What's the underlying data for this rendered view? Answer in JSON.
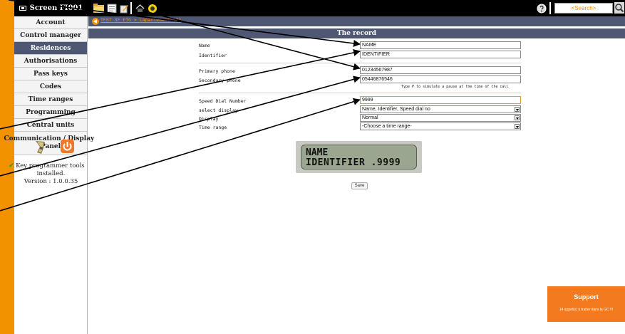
{
  "topbar": {
    "screen_label": "Screen FI001",
    "search_placeholder": "<Search>"
  },
  "sidebar": {
    "items": [
      {
        "label": "Account"
      },
      {
        "label": "Control manager"
      },
      {
        "label": "Residences",
        "active": true
      },
      {
        "label": "Authorisations"
      },
      {
        "label": "Pass keys"
      },
      {
        "label": "Codes"
      },
      {
        "label": "Time ranges"
      },
      {
        "label": "Programming"
      },
      {
        "label": "Central units"
      },
      {
        "label_line1": "Communication / Display",
        "label_line2": "Panel"
      }
    ],
    "programmer": {
      "line1": "Key programmer tools",
      "line2": "installed.",
      "line3": "Version : 1.0.0.35"
    }
  },
  "breadcrumb": {
    "text": "TEST 3E ETG > Lapartement 101"
  },
  "record": {
    "title": "The record"
  },
  "form": {
    "name_label": "Name",
    "name_value": "NAME",
    "identifier_label": "Identifier",
    "identifier_value": "IDENTIFIER",
    "primary_phone_label": "Primary phone",
    "primary_phone_value": "01234567987",
    "secondary_phone_label": "Secondary phone",
    "secondary_phone_value": "05446876546",
    "hint": "Type P to simulate a pause at the time of the call",
    "speed_dial_label": "Speed Dial Number",
    "speed_dial_value": "9999",
    "select_display_label": "select display",
    "select_display_value": "Name, Identifier, Speed dial no",
    "display_label": "Display",
    "display_value": "Normal",
    "time_range_label": "Time range",
    "time_range_value": "-Choose a time range-"
  },
  "lcd": {
    "line1": "NAME",
    "line2": "IDENTIFIER .9999"
  },
  "save_label": "Save",
  "support": {
    "title": "Support",
    "subtitle": "14 appel(s) à traiter dans la GC !!!"
  },
  "colors": {
    "orange": "#f39200",
    "navy": "#4f5873",
    "support": "#f37a1f"
  }
}
